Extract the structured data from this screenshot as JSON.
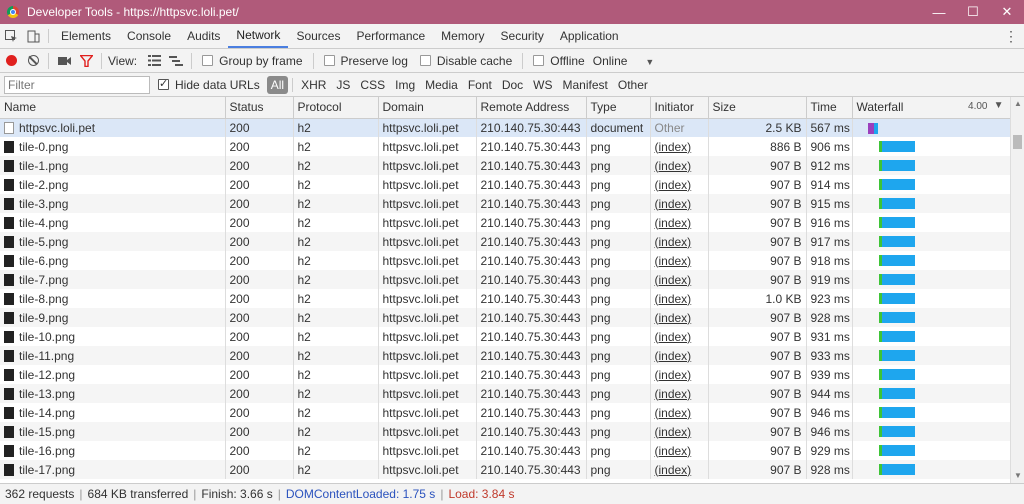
{
  "window": {
    "title": "Developer Tools - https://httpsvc.loli.pet/",
    "minimize": "—",
    "maximize": "☐",
    "close": "✕"
  },
  "tabs": [
    "Elements",
    "Console",
    "Audits",
    "Network",
    "Sources",
    "Performance",
    "Memory",
    "Security",
    "Application"
  ],
  "active_tab": "Network",
  "toolbar": {
    "view_label": "View:",
    "group_by_frame": "Group by frame",
    "preserve_log": "Preserve log",
    "disable_cache": "Disable cache",
    "offline": "Offline",
    "throttle": "Online"
  },
  "filter": {
    "placeholder": "Filter",
    "hide_data_urls": "Hide data URLs",
    "types": [
      "All",
      "XHR",
      "JS",
      "CSS",
      "Img",
      "Media",
      "Font",
      "Doc",
      "WS",
      "Manifest",
      "Other"
    ],
    "active_type": "All"
  },
  "columns": {
    "name": "Name",
    "status": "Status",
    "protocol": "Protocol",
    "domain": "Domain",
    "remote": "Remote Address",
    "type": "Type",
    "initiator": "Initiator",
    "size": "Size",
    "time": "Time",
    "waterfall": "Waterfall",
    "waterfall_scale": "4.00"
  },
  "rows": [
    {
      "name": "httpsvc.loli.pet",
      "status": "200",
      "protocol": "h2",
      "domain": "httpsvc.loli.pet",
      "remote": "210.140.75.30:443",
      "type": "document",
      "initiator": "Other",
      "size": "2.5 KB",
      "time": "567 ms"
    },
    {
      "name": "tile-0.png",
      "status": "200",
      "protocol": "h2",
      "domain": "httpsvc.loli.pet",
      "remote": "210.140.75.30:443",
      "type": "png",
      "initiator": "(index)",
      "size": "886 B",
      "time": "906 ms"
    },
    {
      "name": "tile-1.png",
      "status": "200",
      "protocol": "h2",
      "domain": "httpsvc.loli.pet",
      "remote": "210.140.75.30:443",
      "type": "png",
      "initiator": "(index)",
      "size": "907 B",
      "time": "912 ms"
    },
    {
      "name": "tile-2.png",
      "status": "200",
      "protocol": "h2",
      "domain": "httpsvc.loli.pet",
      "remote": "210.140.75.30:443",
      "type": "png",
      "initiator": "(index)",
      "size": "907 B",
      "time": "914 ms"
    },
    {
      "name": "tile-3.png",
      "status": "200",
      "protocol": "h2",
      "domain": "httpsvc.loli.pet",
      "remote": "210.140.75.30:443",
      "type": "png",
      "initiator": "(index)",
      "size": "907 B",
      "time": "915 ms"
    },
    {
      "name": "tile-4.png",
      "status": "200",
      "protocol": "h2",
      "domain": "httpsvc.loli.pet",
      "remote": "210.140.75.30:443",
      "type": "png",
      "initiator": "(index)",
      "size": "907 B",
      "time": "916 ms"
    },
    {
      "name": "tile-5.png",
      "status": "200",
      "protocol": "h2",
      "domain": "httpsvc.loli.pet",
      "remote": "210.140.75.30:443",
      "type": "png",
      "initiator": "(index)",
      "size": "907 B",
      "time": "917 ms"
    },
    {
      "name": "tile-6.png",
      "status": "200",
      "protocol": "h2",
      "domain": "httpsvc.loli.pet",
      "remote": "210.140.75.30:443",
      "type": "png",
      "initiator": "(index)",
      "size": "907 B",
      "time": "918 ms"
    },
    {
      "name": "tile-7.png",
      "status": "200",
      "protocol": "h2",
      "domain": "httpsvc.loli.pet",
      "remote": "210.140.75.30:443",
      "type": "png",
      "initiator": "(index)",
      "size": "907 B",
      "time": "919 ms"
    },
    {
      "name": "tile-8.png",
      "status": "200",
      "protocol": "h2",
      "domain": "httpsvc.loli.pet",
      "remote": "210.140.75.30:443",
      "type": "png",
      "initiator": "(index)",
      "size": "1.0 KB",
      "time": "923 ms"
    },
    {
      "name": "tile-9.png",
      "status": "200",
      "protocol": "h2",
      "domain": "httpsvc.loli.pet",
      "remote": "210.140.75.30:443",
      "type": "png",
      "initiator": "(index)",
      "size": "907 B",
      "time": "928 ms"
    },
    {
      "name": "tile-10.png",
      "status": "200",
      "protocol": "h2",
      "domain": "httpsvc.loli.pet",
      "remote": "210.140.75.30:443",
      "type": "png",
      "initiator": "(index)",
      "size": "907 B",
      "time": "931 ms"
    },
    {
      "name": "tile-11.png",
      "status": "200",
      "protocol": "h2",
      "domain": "httpsvc.loli.pet",
      "remote": "210.140.75.30:443",
      "type": "png",
      "initiator": "(index)",
      "size": "907 B",
      "time": "933 ms"
    },
    {
      "name": "tile-12.png",
      "status": "200",
      "protocol": "h2",
      "domain": "httpsvc.loli.pet",
      "remote": "210.140.75.30:443",
      "type": "png",
      "initiator": "(index)",
      "size": "907 B",
      "time": "939 ms"
    },
    {
      "name": "tile-13.png",
      "status": "200",
      "protocol": "h2",
      "domain": "httpsvc.loli.pet",
      "remote": "210.140.75.30:443",
      "type": "png",
      "initiator": "(index)",
      "size": "907 B",
      "time": "944 ms"
    },
    {
      "name": "tile-14.png",
      "status": "200",
      "protocol": "h2",
      "domain": "httpsvc.loli.pet",
      "remote": "210.140.75.30:443",
      "type": "png",
      "initiator": "(index)",
      "size": "907 B",
      "time": "946 ms"
    },
    {
      "name": "tile-15.png",
      "status": "200",
      "protocol": "h2",
      "domain": "httpsvc.loli.pet",
      "remote": "210.140.75.30:443",
      "type": "png",
      "initiator": "(index)",
      "size": "907 B",
      "time": "946 ms"
    },
    {
      "name": "tile-16.png",
      "status": "200",
      "protocol": "h2",
      "domain": "httpsvc.loli.pet",
      "remote": "210.140.75.30:443",
      "type": "png",
      "initiator": "(index)",
      "size": "907 B",
      "time": "929 ms"
    },
    {
      "name": "tile-17.png",
      "status": "200",
      "protocol": "h2",
      "domain": "httpsvc.loli.pet",
      "remote": "210.140.75.30:443",
      "type": "png",
      "initiator": "(index)",
      "size": "907 B",
      "time": "928 ms"
    }
  ],
  "status": {
    "requests": "362 requests",
    "transferred": "684 KB transferred",
    "finish": "Finish: 3.66 s",
    "dom": "DOMContentLoaded: 1.75 s",
    "load": "Load: 3.84 s"
  },
  "colors": {
    "titlebar": "#b05a7a",
    "active_tab_underline": "#4a7ee0",
    "record": "#e0201e",
    "waterfall_wait": "#3ec437",
    "waterfall_receive": "#1ea6ee",
    "dom_content_loaded": "#2a52be",
    "load": "#c0392b"
  }
}
